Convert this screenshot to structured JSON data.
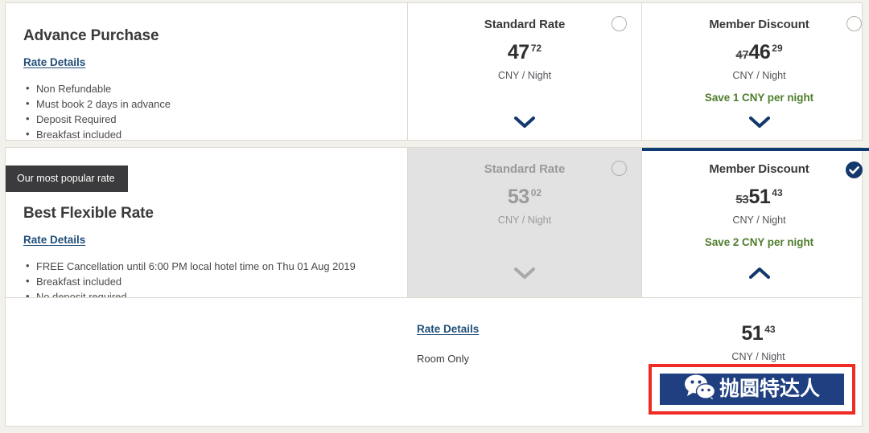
{
  "page": {
    "background_color": "#f2f1ec",
    "accent_navy": "#0d3b6f",
    "link_color": "#1f4e79",
    "save_green": "#4f7c2c",
    "badge_dark": "#3b3b3d"
  },
  "rate_rows": [
    {
      "title": "Advance Purchase",
      "badge": null,
      "rate_details_label": "Rate Details",
      "bullets": [
        "Non Refundable",
        "Must book 2 days in advance",
        "Deposit Required",
        "Breakfast included"
      ],
      "standard": {
        "heading": "Standard Rate",
        "old_price": "",
        "price": "47",
        "cents": "72",
        "per_night": "CNY / Night",
        "save_note": "",
        "selected": false,
        "disabled": false,
        "chevron": "down",
        "radio_state": "unselected"
      },
      "member": {
        "heading": "Member Discount",
        "old_price": "47",
        "price": "46",
        "cents": "29",
        "per_night": "CNY / Night",
        "save_note": "Save 1 CNY per night",
        "selected": false,
        "disabled": false,
        "chevron": "down",
        "radio_state": "unselected"
      }
    },
    {
      "title": "Best Flexible Rate",
      "badge": "Our most popular rate",
      "rate_details_label": "Rate Details",
      "bullets": [
        "FREE Cancellation until 6:00 PM local hotel time on Thu 01 Aug 2019",
        "Breakfast included",
        "No deposit required"
      ],
      "standard": {
        "heading": "Standard Rate",
        "old_price": "",
        "price": "53",
        "cents": "02",
        "per_night": "CNY / Night",
        "save_note": "",
        "selected": false,
        "disabled": true,
        "chevron": "down",
        "radio_state": "unselected"
      },
      "member": {
        "heading": "Member Discount",
        "old_price": "53",
        "price": "51",
        "cents": "43",
        "per_night": "CNY / Night",
        "save_note": "Save 2 CNY per night",
        "selected": true,
        "disabled": false,
        "chevron": "up",
        "radio_state": "selected"
      }
    }
  ],
  "expanded_panel": {
    "rate_details_label": "Rate Details",
    "room_label": "Room Only",
    "price": "51",
    "cents": "43",
    "per_night": "CNY / Night"
  },
  "watermark": {
    "text": "抛圆特达人",
    "icon": "wechat-icon",
    "banner_color": "#1f3f80",
    "outline_color": "#ee2b24"
  }
}
